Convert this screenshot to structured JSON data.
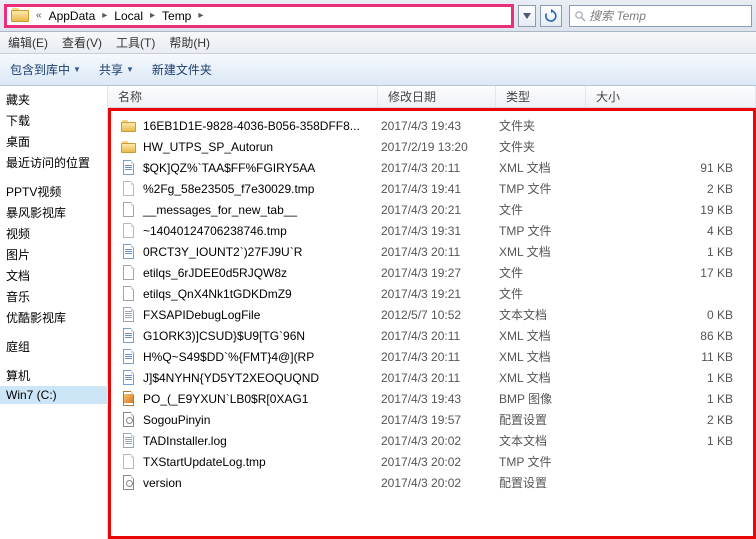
{
  "breadcrumb": {
    "dots": "«",
    "items": [
      "AppData",
      "Local",
      "Temp"
    ]
  },
  "search_placeholder": "搜索 Temp",
  "menu": {
    "m0": "编辑(E)",
    "m1": "查看(V)",
    "m2": "工具(T)",
    "m3": "帮助(H)"
  },
  "toolbar": {
    "organize": "包含到库中",
    "share": "共享",
    "newfolder": "新建文件夹"
  },
  "columns": {
    "name": "名称",
    "date": "修改日期",
    "type": "类型",
    "size": "大小"
  },
  "nav": {
    "items": [
      {
        "label": "藏夹",
        "icon": "star"
      },
      {
        "label": "下载",
        "icon": "dl"
      },
      {
        "label": "桌面",
        "icon": "desk"
      },
      {
        "label": "最近访问的位置",
        "icon": "recent"
      }
    ],
    "groups": [
      {
        "label": "",
        "spacer": true
      },
      {
        "label": "PPTV视频"
      },
      {
        "label": "暴风影视库"
      },
      {
        "label": "视频"
      },
      {
        "label": "图片"
      },
      {
        "label": "文档"
      },
      {
        "label": "音乐"
      },
      {
        "label": "优酷影视库"
      },
      {
        "label": "",
        "spacer": true
      },
      {
        "label": "庭组"
      },
      {
        "label": "",
        "spacer": true
      },
      {
        "label": "算机"
      },
      {
        "label": "Win7 (C:)",
        "sel": true
      }
    ]
  },
  "files": [
    {
      "icon": "folder",
      "name": "16EB1D1E-9828-4036-B056-358DFF8...",
      "date": "2017/4/3 19:43",
      "type": "文件夹",
      "size": ""
    },
    {
      "icon": "folder",
      "name": "HW_UTPS_SP_Autorun",
      "date": "2017/2/19 13:20",
      "type": "文件夹",
      "size": ""
    },
    {
      "icon": "xml",
      "name": "$QK]QZ%`TAA$FF%FGIRY5AA",
      "date": "2017/4/3 20:11",
      "type": "XML 文档",
      "size": "91 KB"
    },
    {
      "icon": "tmp",
      "name": "%2Fg_58e23505_f7e30029.tmp",
      "date": "2017/4/3 19:41",
      "type": "TMP 文件",
      "size": "2 KB"
    },
    {
      "icon": "file",
      "name": "__messages_for_new_tab__",
      "date": "2017/4/3 20:21",
      "type": "文件",
      "size": "19 KB"
    },
    {
      "icon": "tmp",
      "name": "~14040124706238746.tmp",
      "date": "2017/4/3 19:31",
      "type": "TMP 文件",
      "size": "4 KB"
    },
    {
      "icon": "xml",
      "name": "0RCT3Y_IOUNT2`)27FJ9U`R",
      "date": "2017/4/3 20:11",
      "type": "XML 文档",
      "size": "1 KB"
    },
    {
      "icon": "file",
      "name": "etilqs_6rJDEE0d5RJQW8z",
      "date": "2017/4/3 19:27",
      "type": "文件",
      "size": "17 KB"
    },
    {
      "icon": "file",
      "name": "etilqs_QnX4Nk1tGDKDmZ9",
      "date": "2017/4/3 19:21",
      "type": "文件",
      "size": ""
    },
    {
      "icon": "txt",
      "name": "FXSAPIDebugLogFile",
      "date": "2012/5/7 10:52",
      "type": "文本文档",
      "size": "0 KB"
    },
    {
      "icon": "xml",
      "name": "G1ORK3)]CSUD}$U9[TG`96N",
      "date": "2017/4/3 20:11",
      "type": "XML 文档",
      "size": "86 KB"
    },
    {
      "icon": "xml",
      "name": "H%Q~S49$DD`%{FMT}4@](RP",
      "date": "2017/4/3 20:11",
      "type": "XML 文档",
      "size": "11 KB"
    },
    {
      "icon": "xml",
      "name": "J]$4NYHN{YD5YT2XEOQUQND",
      "date": "2017/4/3 20:11",
      "type": "XML 文档",
      "size": "1 KB"
    },
    {
      "icon": "bmp",
      "name": "PO_(_E9YXUN`LB0$R[0XAG1",
      "date": "2017/4/3 19:43",
      "type": "BMP 图像",
      "size": "1 KB"
    },
    {
      "icon": "cfg",
      "name": "SogouPinyin",
      "date": "2017/4/3 19:57",
      "type": "配置设置",
      "size": "2 KB"
    },
    {
      "icon": "txt",
      "name": "TADInstaller.log",
      "date": "2017/4/3 20:02",
      "type": "文本文档",
      "size": "1 KB"
    },
    {
      "icon": "tmp",
      "name": "TXStartUpdateLog.tmp",
      "date": "2017/4/3 20:02",
      "type": "TMP 文件",
      "size": ""
    },
    {
      "icon": "cfg",
      "name": "version",
      "date": "2017/4/3 20:02",
      "type": "配置设置",
      "size": ""
    }
  ]
}
